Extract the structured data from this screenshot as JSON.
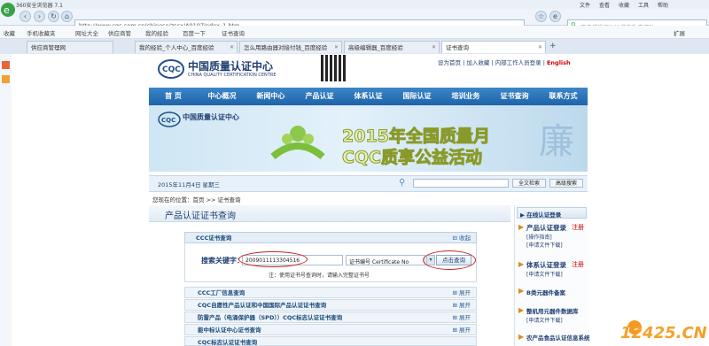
{
  "browser": {
    "window_title": "360安全浏览器 7.1",
    "address": "http://www.cqc.com.cn/chinese/zscx/A0107index_1.htm",
    "search_placeholder": "用户感谢目360搜索礼来源破",
    "menu": [
      "文件",
      "查看",
      "收藏",
      "工具",
      "帮助"
    ],
    "favorites": [
      "收藏",
      "手机收藏夹",
      "网址大全",
      "供应商管",
      "我的经验",
      "百度一下",
      "证书查询"
    ],
    "expand_label": "扩展",
    "tabs": [
      {
        "label": "供应商管理网"
      },
      {
        "label": "我的经验_个人中心_百度经验"
      },
      {
        "label": "怎么用路由器对接付钱_百度经验"
      },
      {
        "label": "高级编辑器_百度经验"
      },
      {
        "label": "证书查询"
      }
    ]
  },
  "site": {
    "logo_main": "中国质量认证中心",
    "logo_sub": "CHINA QUALITY CERTIFICATION CENTRE",
    "top_links": [
      "设为首页",
      "加入收藏",
      "内部工作人员登录",
      "English"
    ],
    "nav": [
      "首 页",
      "中心概况",
      "新闻中心",
      "产品认证",
      "体系认证",
      "国际认证",
      "培训业务",
      "证书查询",
      "联系方式"
    ],
    "banner_line1": "2015年全国质量月",
    "banner_line2": "CQC质享公益活动",
    "banner_char": "廉",
    "date": "2015年11月4日 星期三",
    "search_buttons": [
      "全文检索",
      "高级搜索"
    ],
    "breadcrumb": "您现在的位置：首页 >> 证书查询"
  },
  "main": {
    "title": "产品认证证书查询",
    "box_title": "CCC证书查询",
    "collapse_label": "收起",
    "search_label": "搜索关键字：",
    "search_value": "2009011113304516",
    "select_value": "证书编号 Certificate No",
    "query_button": "点击查询",
    "note": "注：使用证书号查询时，请输入完整证书号",
    "rows": [
      {
        "label": "CCC工厂信息查询",
        "action": "展开"
      },
      {
        "label": "CQC自愿性产品认证和中国国际产品认证证书查询",
        "action": "展开"
      },
      {
        "label": "防雷产品（电涌保护器（SPD））CQC标志认证证书查询",
        "action": "展开"
      },
      {
        "label": "能中标认证中心证书查询",
        "action": "展开"
      },
      {
        "label": "CQC标志认证证书查询",
        "action": "展开"
      }
    ]
  },
  "sidebar": {
    "title": "在线认证登录",
    "items": [
      {
        "label": "产品认证登录",
        "register": "注册",
        "subs": [
          "操作指南",
          "申请文件下载"
        ]
      },
      {
        "label": "体系认证登录",
        "register": "注册",
        "subs": [
          "申请文件下载"
        ]
      },
      {
        "label": "B类元器件备案",
        "register": "",
        "subs": []
      },
      {
        "label": "整机用元器件数据库",
        "register": "",
        "subs": [
          "申请文件下载"
        ]
      },
      {
        "label": "农产品食品认证信息系统",
        "register": "",
        "subs": []
      }
    ]
  },
  "watermark": "12425.CN"
}
